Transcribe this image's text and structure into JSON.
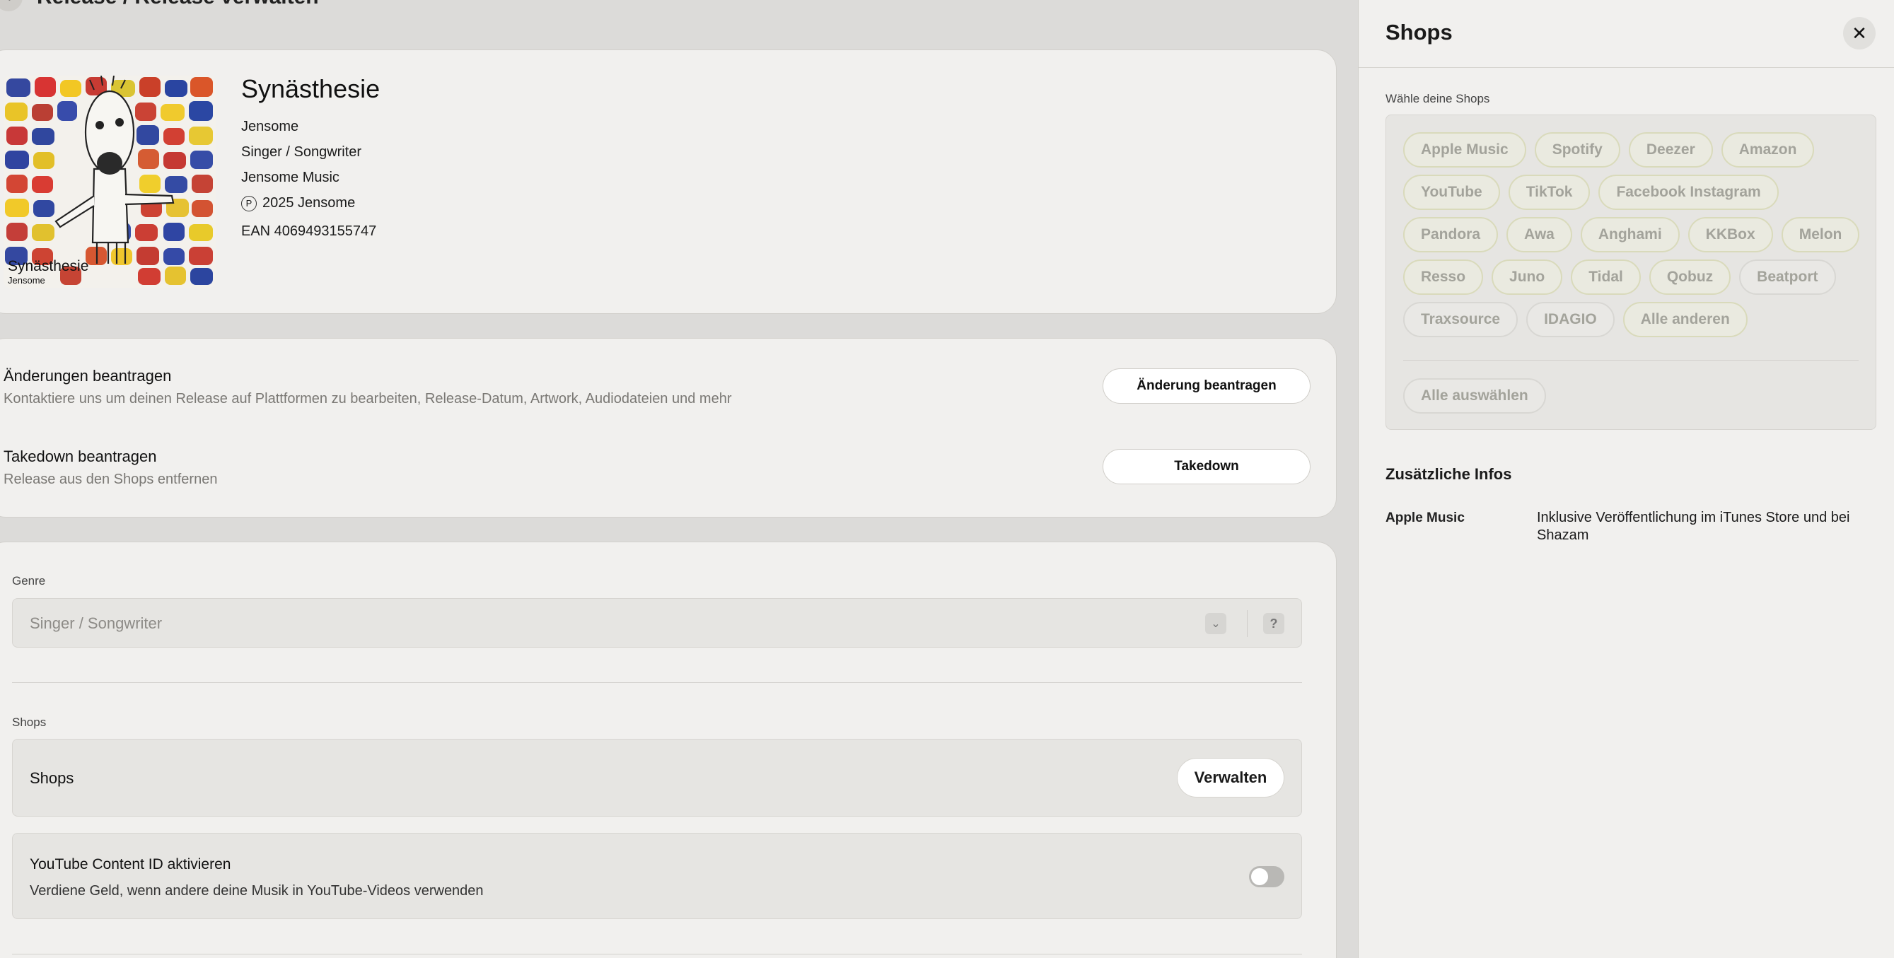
{
  "header": {
    "breadcrumb": "Release / Release verwalten"
  },
  "release": {
    "title": "Synästhesie",
    "artist": "Jensome",
    "genre": "Singer / Songwriter",
    "label": "Jensome Music",
    "copyright_symbol": "P",
    "copyright": "2025 Jensome",
    "ean": "EAN 4069493155747",
    "artwork_title": "Synästhesie",
    "artwork_artist": "Jensome"
  },
  "actions": {
    "change": {
      "title": "Änderungen beantragen",
      "subtitle": "Kontaktiere uns um deinen Release auf Plattformen zu bearbeiten, Release-Datum, Artwork, Audiodateien und mehr",
      "button": "Änderung beantragen"
    },
    "takedown": {
      "title": "Takedown beantragen",
      "subtitle": "Release aus den Shops entfernen",
      "button": "Takedown"
    }
  },
  "form": {
    "genre_label": "Genre",
    "genre_value": "Singer / Songwriter",
    "help": "?",
    "shops_label": "Shops",
    "shops_box_title": "Shops",
    "manage_button": "Verwalten",
    "youtube_title": "YouTube Content ID aktivieren",
    "youtube_subtitle": "Verdiene Geld, wenn andere deine Musik in YouTube-Videos verwenden",
    "youtube_enabled": false
  },
  "panel": {
    "title": "Shops",
    "close": "✕",
    "choose_label": "Wähle deine Shops",
    "shops": [
      [
        "Apple Music",
        "Spotify",
        "Deezer",
        "Amazon"
      ],
      [
        "YouTube",
        "TikTok",
        "Facebook Instagram"
      ],
      [
        "Pandora",
        "Awa",
        "Anghami",
        "KKBox",
        "Melon"
      ],
      [
        "Resso",
        "Juno",
        "Tidal",
        "Qobuz",
        "Beatport"
      ],
      [
        "Traxsource",
        "IDAGIO",
        "Alle anderen"
      ]
    ],
    "select_all": "Alle auswählen",
    "extra_title": "Zusätzliche Infos",
    "extra_key": "Apple Music",
    "extra_value": "Inklusive Veröffentlichung im iTunes Store und bei Shazam"
  }
}
